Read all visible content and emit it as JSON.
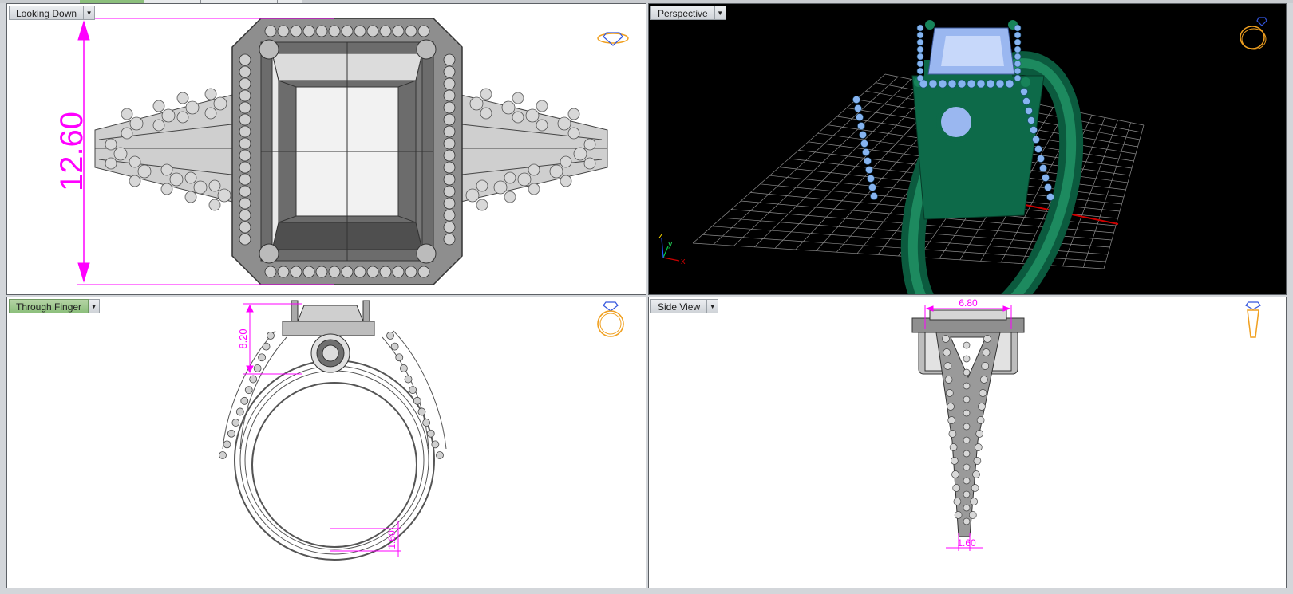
{
  "viewports": {
    "top": {
      "label": "Looking Down",
      "dimension": "12.60"
    },
    "perspective": {
      "label": "Perspective"
    },
    "front": {
      "label": "Through Finger",
      "dimension_height": "8.20",
      "dimension_shank": "1.60"
    },
    "side": {
      "label": "Side View",
      "dimension_width": "6.80",
      "dimension_shank": "1.60"
    }
  },
  "dropdown_glyph": "▼",
  "axis_labels": {
    "x": "x",
    "y": "y",
    "z": "z"
  },
  "colors": {
    "viewport_bg_light": "#ffffff",
    "viewport_bg_dark": "#000000",
    "dimension": "#ff00ff",
    "active_label": "#8cbf7c",
    "metal_render": "#0e6b4a",
    "gem_render": "#9ab7f0",
    "grid": "#9a9a9a",
    "x_axis": "#cc0000",
    "z_axis": "#00b0c8",
    "orientation_icon": "#f0a020"
  },
  "icons": [
    "ring-orientation-icon",
    "dropdown-arrow-icon",
    "axis-triad-icon"
  ]
}
